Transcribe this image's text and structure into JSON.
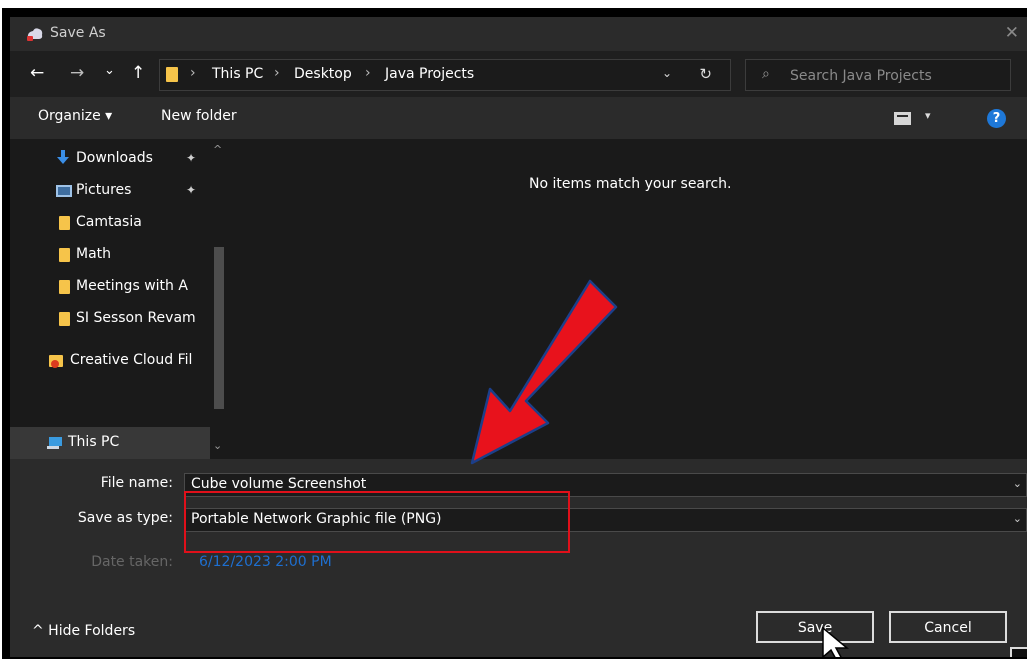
{
  "window": {
    "title": "Save As",
    "close_glyph": "✕"
  },
  "nav": {
    "back_glyph": "←",
    "forward_glyph": "→",
    "recent_glyph": "⌄",
    "up_glyph": "↑",
    "breadcrumb": [
      "This PC",
      "Desktop",
      "Java Projects"
    ],
    "separator": "›",
    "dropdown_glyph": "⌄",
    "refresh_glyph": "↻"
  },
  "search": {
    "placeholder": "Search Java Projects",
    "icon": "search-icon"
  },
  "toolbar": {
    "organize_label": "Organize ▾",
    "new_folder_label": "New folder",
    "view_dropdown_glyph": "▾",
    "help_glyph": "?"
  },
  "sidebar": {
    "items": [
      {
        "label": "Downloads",
        "icon": "downloads-icon",
        "pinned": true
      },
      {
        "label": "Pictures",
        "icon": "pictures-icon",
        "pinned": true
      },
      {
        "label": "Camtasia",
        "icon": "folder-icon"
      },
      {
        "label": "Math",
        "icon": "folder-icon"
      },
      {
        "label": "Meetings with A",
        "icon": "folder-icon"
      },
      {
        "label": "SI Sesson Revam",
        "icon": "folder-icon"
      },
      {
        "label": "Creative Cloud Fil",
        "icon": "creative-cloud-icon"
      },
      {
        "label": "This PC",
        "icon": "this-pc-icon",
        "selected": true
      }
    ],
    "pin_glyph": "📌"
  },
  "content": {
    "empty_message": "No items match your search."
  },
  "form": {
    "file_name_label": "File name:",
    "file_name_value": "Cube volume Screenshot",
    "save_type_label": "Save as type:",
    "save_type_value": "Portable Network Graphic file (PNG)",
    "date_taken_label": "Date taken:",
    "date_taken_value": "6/12/2023 2:00 PM"
  },
  "footer": {
    "hide_folders_label": "^  Hide Folders",
    "save_label": "Save",
    "cancel_label": "Cancel"
  },
  "colors": {
    "annotation_arrow": "#e8121c",
    "highlight_box": "#e0101a",
    "accent_blue": "#1e78d8"
  }
}
